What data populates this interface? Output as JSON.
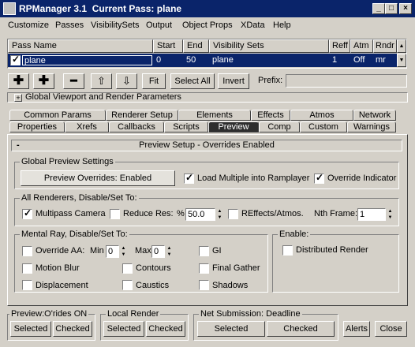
{
  "title": {
    "app": "RPManager 3.1",
    "pass": "Current Pass: plane"
  },
  "window_controls": {
    "minimize": "_",
    "maximize": "□",
    "close": "×"
  },
  "menu": [
    "Customize",
    "Passes",
    "VisibilitySets",
    "Output",
    "Object Props",
    "XData",
    "Help"
  ],
  "table": {
    "headers": [
      "Pass Name",
      "Start",
      "End",
      "Visibility Sets",
      "Reff",
      "Atm",
      "Rndr"
    ],
    "row": {
      "name": "plane",
      "start": "0",
      "end": "50",
      "vis": "plane",
      "reff": "1",
      "atm": "Off",
      "rndr": "mr"
    },
    "checked": true
  },
  "toolbar": {
    "fit": "Fit",
    "select_all": "Select All",
    "invert": "Invert",
    "prefix": "Prefix:",
    "prefix_value": ""
  },
  "rollout_global": {
    "toggle": "+",
    "label": "Global Viewport and Render Parameters"
  },
  "tabs_row1": [
    "Common Params",
    "Renderer Setup",
    "Elements",
    "Effects",
    "Atmos",
    "Network"
  ],
  "tabs_row2": [
    "Properties",
    "Xrefs",
    "Callbacks",
    "Scripts",
    "Preview",
    "Comp",
    "Custom",
    "Warnings"
  ],
  "active_tab": "Preview",
  "preview_rollout": {
    "toggle": "-",
    "label": "Preview Setup - Overrides Enabled"
  },
  "global_preview": {
    "title": "Global Preview Settings",
    "overrides_button": "Preview Overrides: Enabled",
    "load_multiple": "Load Multiple into Ramplayer",
    "override_indicator": "Override Indicator"
  },
  "all_renderers": {
    "title": "All Renderers, Disable/Set To:",
    "multipass": "Multipass Camera",
    "reduce_res": "Reduce Res:",
    "pct": "%",
    "reduce_value": "50.0",
    "reffects": "REffects/Atmos.",
    "nth_frame": "Nth Frame:",
    "nth_value": "1"
  },
  "mental_ray": {
    "title": "Mental Ray, Disable/Set To:",
    "override_aa": "Override AA:",
    "min": "Min",
    "min_value": "0",
    "max": "Max",
    "max_value": "0",
    "gi": "GI",
    "motion_blur": "Motion Blur",
    "contours": "Contours",
    "final_gather": "Final Gather",
    "displacement": "Displacement",
    "caustics": "Caustics",
    "shadows": "Shadows"
  },
  "enable": {
    "title": "Enable:",
    "distributed": "Distributed Render"
  },
  "bottom": {
    "preview_group": "Preview:O'rides ON",
    "local_group": "Local Render",
    "net_group": "Net Submission: Deadline",
    "selected": "Selected",
    "checked": "Checked",
    "alerts": "Alerts",
    "close": "Close"
  },
  "colors": {
    "titlebar": "#0a246a",
    "face": "#d4d0c8",
    "selection": "#0a246a"
  }
}
